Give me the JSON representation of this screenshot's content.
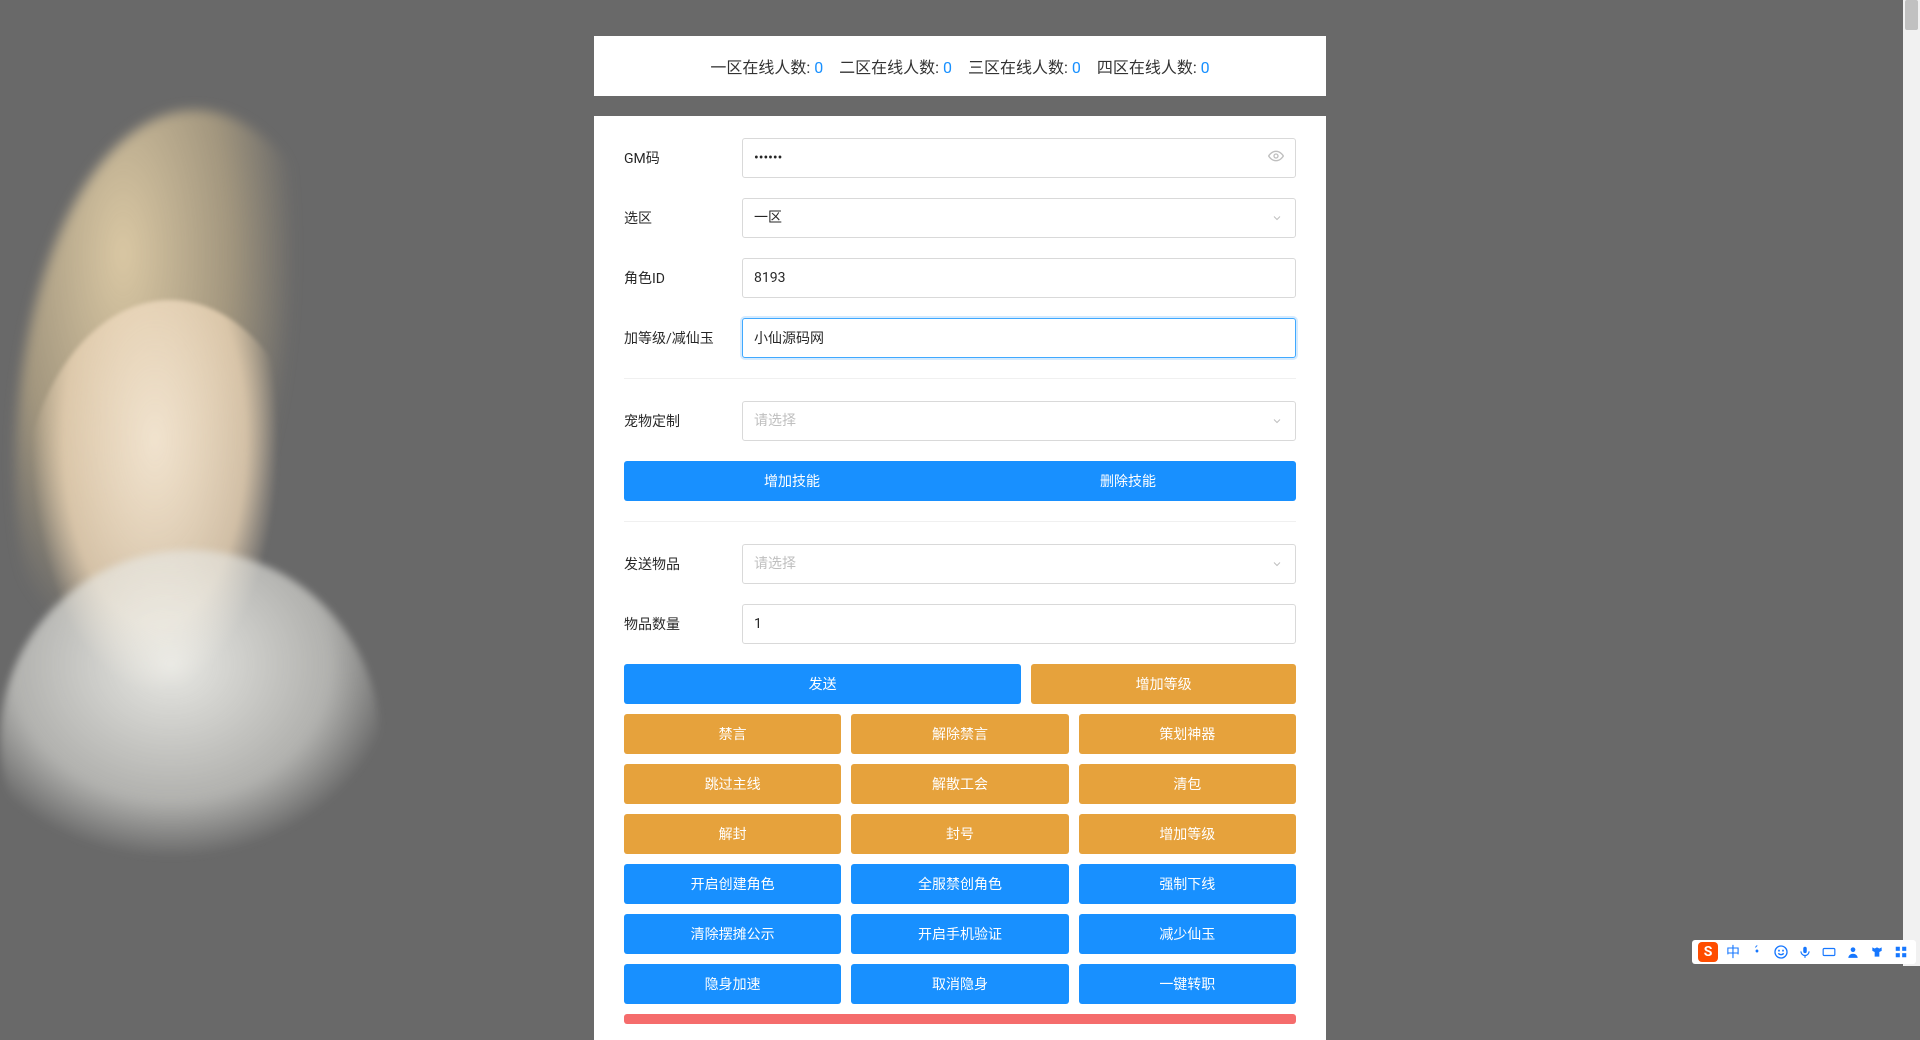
{
  "status": {
    "items": [
      {
        "label": "一区在线人数:",
        "value": "0"
      },
      {
        "label": "二区在线人数:",
        "value": "0"
      },
      {
        "label": "三区在线人数:",
        "value": "0"
      },
      {
        "label": "四区在线人数:",
        "value": "0"
      }
    ]
  },
  "form": {
    "gm_code": {
      "label": "GM码",
      "value": "••••••"
    },
    "zone": {
      "label": "选区",
      "value": "一区"
    },
    "role_id": {
      "label": "角色ID",
      "value": "8193"
    },
    "level_jade": {
      "label": "加等级/减仙玉",
      "value": "小仙源码网"
    },
    "pet_custom": {
      "label": "宠物定制",
      "placeholder": "请选择"
    },
    "send_item": {
      "label": "发送物品",
      "placeholder": "请选择"
    },
    "item_qty": {
      "label": "物品数量",
      "value": "1"
    }
  },
  "buttons": {
    "add_skill": "增加技能",
    "del_skill": "删除技能",
    "send": "发送",
    "add_level": "增加等级",
    "row1": [
      "禁言",
      "解除禁言",
      "策划神器"
    ],
    "row2": [
      "跳过主线",
      "解散工会",
      "清包"
    ],
    "row3": [
      "解封",
      "封号",
      "增加等级"
    ],
    "row4": [
      "开启创建角色",
      "全服禁创角色",
      "强制下线"
    ],
    "row5": [
      "清除摆摊公示",
      "开启手机验证",
      "减少仙玉"
    ],
    "row6": [
      "隐身加速",
      "取消隐身",
      "一键转职"
    ]
  },
  "ime": {
    "lang": "中"
  }
}
